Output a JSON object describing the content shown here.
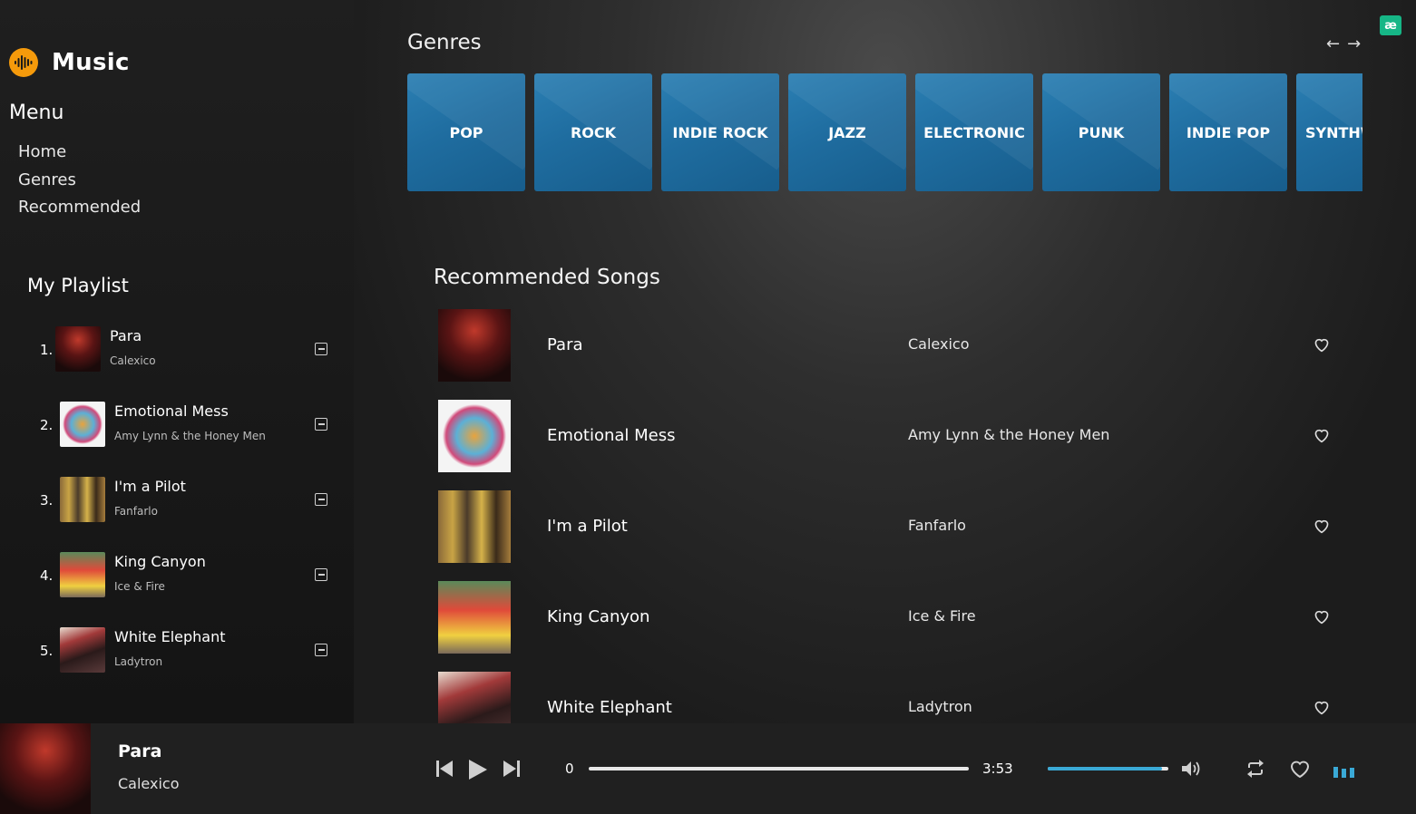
{
  "app": {
    "name": "Music",
    "badge": "æ"
  },
  "menu": {
    "title": "Menu",
    "items": [
      {
        "label": "Home"
      },
      {
        "label": "Genres"
      },
      {
        "label": "Recommended"
      }
    ]
  },
  "playlist": {
    "title": "My Playlist",
    "items": [
      {
        "num": "1.",
        "title": "Para",
        "artist": "Calexico",
        "thumb": "concert-stage-red"
      },
      {
        "num": "2.",
        "title": "Emotional Mess",
        "artist": "Amy Lynn & the Honey Men",
        "thumb": "colorful-circle-art"
      },
      {
        "num": "3.",
        "title": "I'm a Pilot",
        "artist": "Fanfarlo",
        "thumb": "band-group-photo"
      },
      {
        "num": "4.",
        "title": "King Canyon",
        "artist": "Ice & Fire",
        "thumb": "duo-colorful-outfits"
      },
      {
        "num": "5.",
        "title": "White Elephant",
        "artist": "Ladytron",
        "thumb": "band-portrait-dark"
      }
    ]
  },
  "genres": {
    "title": "Genres",
    "items": [
      {
        "label": "POP"
      },
      {
        "label": "ROCK"
      },
      {
        "label": "INDIE ROCK"
      },
      {
        "label": "JAZZ"
      },
      {
        "label": "ELECTRONIC"
      },
      {
        "label": "PUNK"
      },
      {
        "label": "INDIE POP"
      },
      {
        "label": "SYNTHWAVE"
      }
    ],
    "card_color": "#1f6da0"
  },
  "recommended": {
    "title": "Recommended Songs",
    "items": [
      {
        "title": "Para",
        "artist": "Calexico",
        "thumb": "concert-stage-red"
      },
      {
        "title": "Emotional Mess",
        "artist": "Amy Lynn & the Honey Men",
        "thumb": "colorful-circle-art"
      },
      {
        "title": "I'm a Pilot",
        "artist": "Fanfarlo",
        "thumb": "band-group-photo"
      },
      {
        "title": "King Canyon",
        "artist": "Ice & Fire",
        "thumb": "duo-colorful-outfits"
      },
      {
        "title": "White Elephant",
        "artist": "Ladytron",
        "thumb": "band-portrait-dark"
      }
    ]
  },
  "player": {
    "title": "Para",
    "artist": "Calexico",
    "current_time": "0",
    "total_time": "3:53",
    "progress": 0.0,
    "volume": 0.95,
    "accent": "#3aa9d6"
  },
  "icons": {
    "logo": "soundwave-icon",
    "prev": "skip-back-icon",
    "play": "play-icon",
    "next": "skip-forward-icon",
    "volume": "volume-icon",
    "repeat": "repeat-icon",
    "like": "heart-icon",
    "visualizer": "equalizer-icon"
  }
}
